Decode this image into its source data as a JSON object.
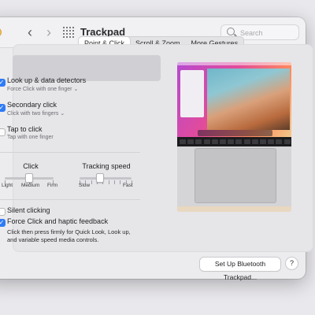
{
  "window": {
    "title": "Trackpad",
    "back_glyph": "‹",
    "forward_glyph": "›",
    "search_placeholder": "Search"
  },
  "tabs": [
    {
      "label": "Point & Click",
      "active": true
    },
    {
      "label": "Scroll & Zoom",
      "active": false
    },
    {
      "label": "More Gestures",
      "active": false
    }
  ],
  "options": {
    "lookup": {
      "title": "Look up & data detectors",
      "sub": "Force Click with one finger",
      "checked": true
    },
    "secondary": {
      "title": "Secondary click",
      "sub": "Click with two fingers",
      "checked": true
    },
    "tap": {
      "title": "Tap to click",
      "sub": "Tap with one finger",
      "checked": false
    }
  },
  "click_slider": {
    "title": "Click",
    "labels": [
      "Light",
      "Medium",
      "Firm"
    ],
    "value_index": 1
  },
  "tracking_slider": {
    "title": "Tracking speed",
    "labels": [
      "Slow",
      "Fast"
    ],
    "level_fraction": 0.4
  },
  "silent": {
    "title": "Silent clicking",
    "checked": false
  },
  "force": {
    "title": "Force Click and haptic feedback",
    "checked": true,
    "desc_line1": "Click then press firmly for Quick Look, Look up,",
    "desc_line2": "and variable speed media controls."
  },
  "checkmark_glyph": "✓",
  "dropdown_glyph": "⌄",
  "footer": {
    "bluetooth_button": "Set Up Bluetooth Trackpad...",
    "help": "?"
  },
  "colors": {
    "accent": "#2f7bf6",
    "window_bg": "#ecebed"
  },
  "icons": {
    "search": "search-icon",
    "grid": "grid-icon",
    "back": "chevron-left-icon",
    "forward": "chevron-right-icon"
  }
}
